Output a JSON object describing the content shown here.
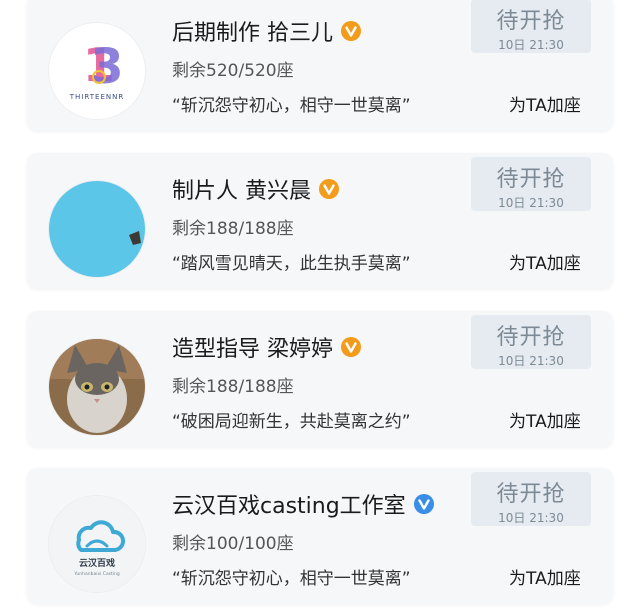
{
  "cards": [
    {
      "name": "后期制作 拾三儿",
      "verified_color": "#f39b1a",
      "seats": "剩余520/520座",
      "quote": "“斩沉怨守初心，相守一世莫离”",
      "grab_label": "待开抢",
      "grab_time": "10日 21:30",
      "add_label": "为TA加座",
      "avatar": {
        "type": "logo-13",
        "logo_text": "THIRTEENNR"
      }
    },
    {
      "name": "制片人 黄兴晨",
      "verified_color": "#f39b1a",
      "seats": "剩余188/188座",
      "quote": "“踏风雪见晴天，此生执手莫离”",
      "grab_label": "待开抢",
      "grab_time": "10日 21:30",
      "add_label": "为TA加座",
      "avatar": {
        "type": "solid-blue",
        "color": "#5cc6e8"
      }
    },
    {
      "name": "造型指导 梁婷婷",
      "verified_color": "#f39b1a",
      "seats": "剩余188/188座",
      "quote": "“破困局迎新生，共赴莫离之约”",
      "grab_label": "待开抢",
      "grab_time": "10日 21:30",
      "add_label": "为TA加座",
      "avatar": {
        "type": "cat-photo"
      }
    },
    {
      "name": "云汉百戏casting工作室",
      "verified_color": "#3a8ee6",
      "seats": "剩余100/100座",
      "quote": "“斩沉怨守初心，相守一世莫离”",
      "grab_label": "待开抢",
      "grab_time": "10日 21:30",
      "add_label": "为TA加座",
      "avatar": {
        "type": "yunhan-logo",
        "logo_text": "云汉百戏",
        "logo_subtext": "Yunhanbaixi Casting"
      }
    }
  ]
}
